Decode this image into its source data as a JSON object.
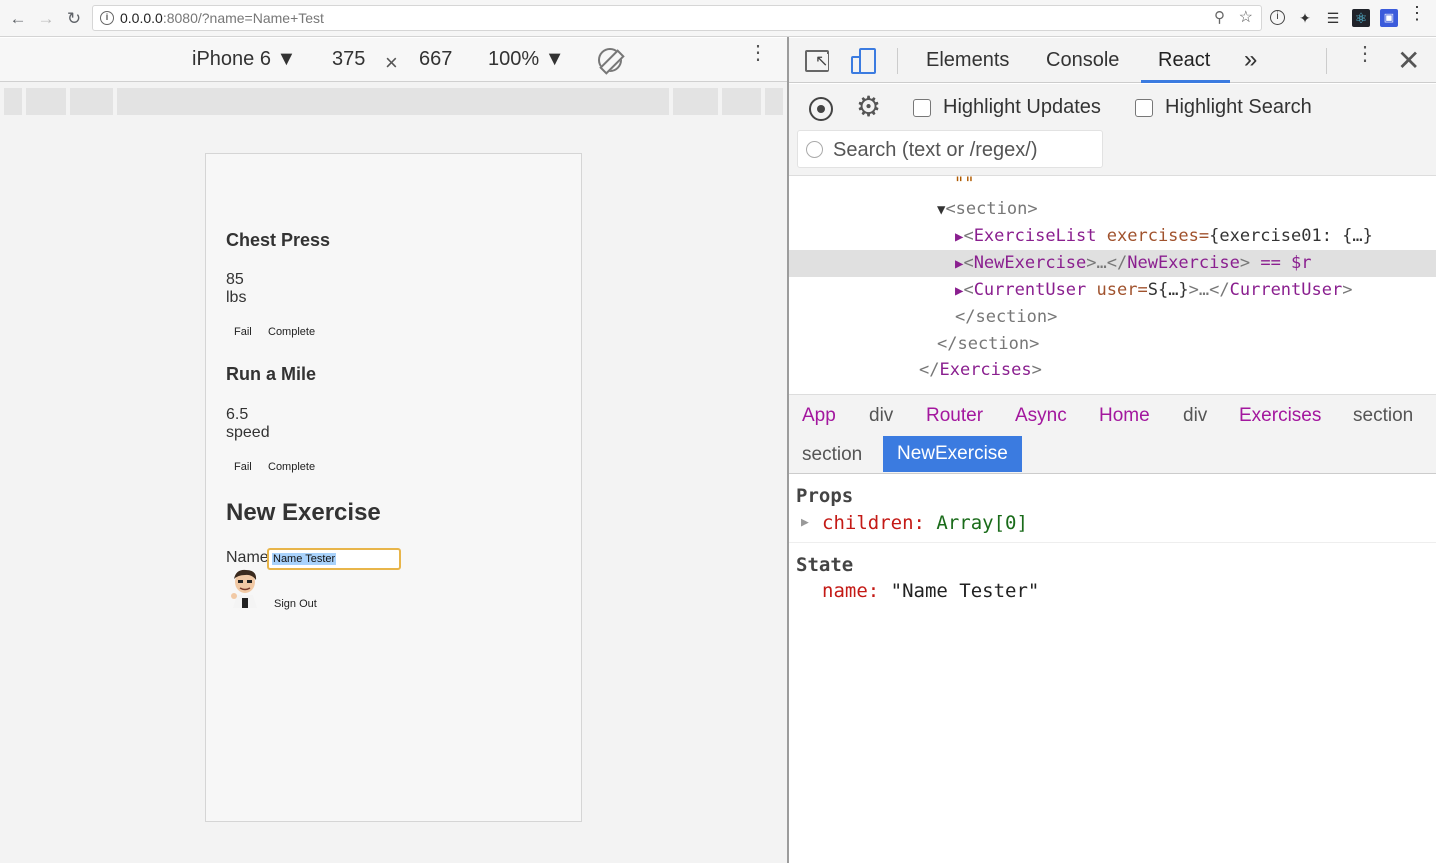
{
  "browser": {
    "url_host": "0.0.0.0",
    "url_rest": ":8080/?name=Name+Test"
  },
  "device_toolbar": {
    "device": "iPhone 6 ▼",
    "width": "375",
    "times": "×",
    "height": "667",
    "zoom": "100% ▼"
  },
  "app": {
    "exercises": [
      {
        "title": "Chest Press",
        "value": "85",
        "unit": "lbs",
        "fail_label": "Fail",
        "complete_label": "Complete"
      },
      {
        "title": "Run a Mile",
        "value": "6.5",
        "unit": "speed",
        "fail_label": "Fail",
        "complete_label": "Complete"
      }
    ],
    "new_exercise_title": "New Exercise",
    "name_label": "Name",
    "name_value": "Name Tester",
    "sign_out_label": "Sign Out"
  },
  "devtools": {
    "tabs": [
      "Elements",
      "Console",
      "React"
    ],
    "overflow": "»",
    "active_tab": "React",
    "toolbar": {
      "highlight_updates": "Highlight Updates",
      "highlight_search": "Highlight Search",
      "search_placeholder": "Search (text or /regex/)"
    },
    "tree": {
      "quote": "\"\"",
      "section_open": "<section>",
      "exercise_list_tag": "ExerciseList",
      "exercise_list_attr": "exercises=",
      "exercise_list_val": "{exercise01: {…}",
      "new_exercise_tag": "NewExercise",
      "new_exercise_mid": ">…</",
      "new_exercise_suffix": "== $r",
      "current_user_tag": "CurrentUser",
      "current_user_attr": "user=",
      "current_user_val": "S{…}",
      "current_user_mid": ">…</",
      "section_close": "</section>",
      "exercises_close_tag": "Exercises"
    },
    "breadcrumbs": {
      "row1": [
        {
          "label": "App",
          "kind": "comp"
        },
        {
          "label": "div",
          "kind": "dom"
        },
        {
          "label": "Router",
          "kind": "comp"
        },
        {
          "label": "Async",
          "kind": "comp"
        },
        {
          "label": "Home",
          "kind": "comp"
        },
        {
          "label": "div",
          "kind": "dom"
        },
        {
          "label": "Exercises",
          "kind": "comp"
        },
        {
          "label": "section",
          "kind": "dom"
        }
      ],
      "row2": [
        {
          "label": "section",
          "kind": "dom"
        },
        {
          "label": "NewExercise",
          "kind": "selected"
        }
      ]
    },
    "props": {
      "title": "Props",
      "key": "children:",
      "value": "Array[0]"
    },
    "state": {
      "title": "State",
      "key": "name:",
      "value": "\"Name Tester\""
    }
  }
}
